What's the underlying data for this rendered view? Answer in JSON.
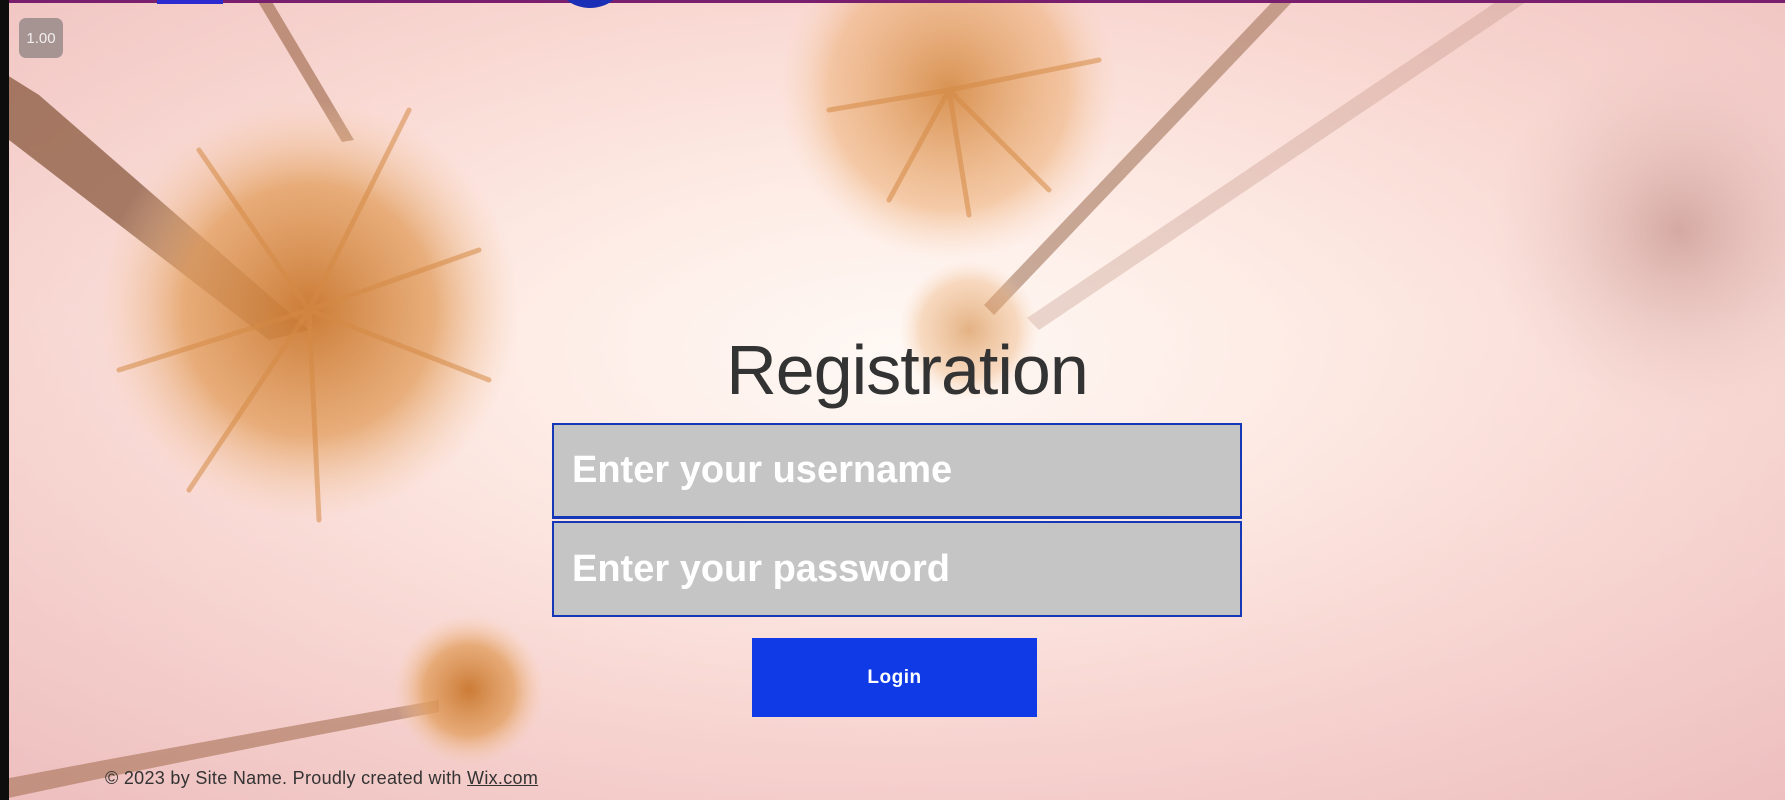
{
  "zoom_indicator": "1.00",
  "form": {
    "title": "Registration",
    "username_placeholder": "Enter your username",
    "password_placeholder": "Enter your password",
    "login_label": "Login"
  },
  "footer": {
    "text": "© 2023 by Site Name. Proudly created with ",
    "link_label": "Wix.com"
  },
  "colors": {
    "accent_blue": "#103ae6",
    "field_border": "#1638b8",
    "field_bg": "#c5c5c5",
    "title_text": "#333333",
    "top_bar": "#7a1e6e"
  },
  "icons": {
    "background": "palm-trees-photo"
  }
}
